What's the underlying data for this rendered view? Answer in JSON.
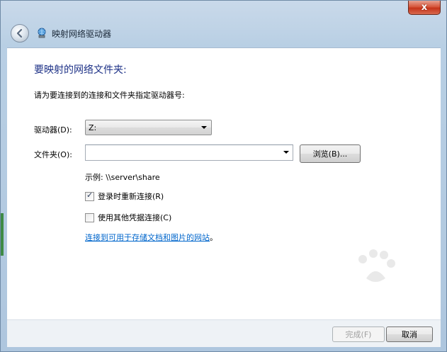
{
  "window": {
    "close_symbol": "x",
    "title": "映射网络驱动器"
  },
  "icons": {
    "back": "back-arrow-icon",
    "network_drive": "network-drive-icon",
    "close": "close-icon",
    "dropdown": "chevron-down-icon",
    "checkmark": "checkmark-icon"
  },
  "main": {
    "heading": "要映射的网络文件夹:",
    "instruction": "请为要连接到的连接和文件夹指定驱动器号:",
    "drive_label": "驱动器(D):",
    "drive_value": "Z:",
    "folder_label": "文件夹(O):",
    "folder_value": "",
    "browse_label": "浏览(B)...",
    "example_text": "示例: \\\\server\\share",
    "reconnect_label": "登录时重新连接(R)",
    "reconnect_checked": true,
    "other_credentials_label": "使用其他凭据连接(C)",
    "other_credentials_checked": false,
    "link_text": "连接到可用于存储文档和图片的网站",
    "link_suffix": "。"
  },
  "footer": {
    "finish_label": "完成(F)",
    "cancel_label": "取消"
  },
  "colors": {
    "heading": "#1e3287",
    "link": "#0066cc",
    "close_button": "#c5341a",
    "window_frame": "#bfd3e6"
  }
}
